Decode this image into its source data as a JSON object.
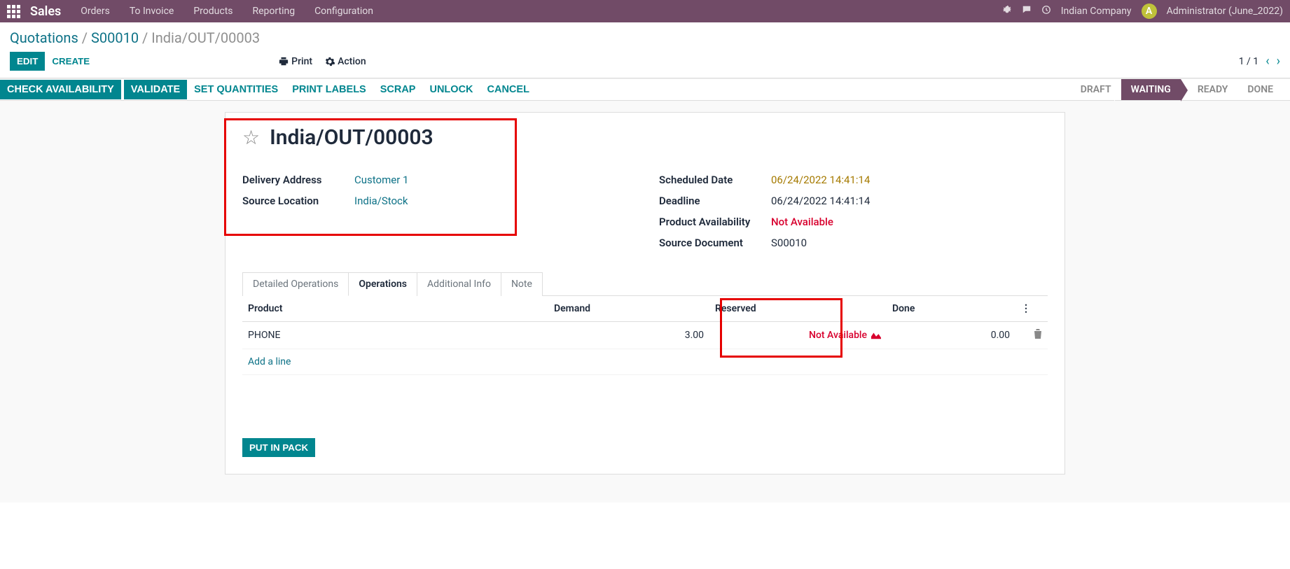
{
  "topnav": {
    "app_name": "Sales",
    "menu": [
      "Orders",
      "To Invoice",
      "Products",
      "Reporting",
      "Configuration"
    ],
    "company": "Indian Company",
    "avatar_letter": "A",
    "user": "Administrator (June_2022)"
  },
  "breadcrumb": {
    "root": "Quotations",
    "parent": "S00010",
    "current": "India/OUT/00003"
  },
  "actions": {
    "edit": "EDIT",
    "create": "CREATE",
    "print": "Print",
    "action": "Action",
    "pager": "1 / 1"
  },
  "statusbar": {
    "buttons": {
      "check_availability": "CHECK AVAILABILITY",
      "validate": "VALIDATE",
      "set_quantities": "SET QUANTITIES",
      "print_labels": "PRINT LABELS",
      "scrap": "SCRAP",
      "unlock": "UNLOCK",
      "cancel": "CANCEL"
    },
    "statuses": {
      "draft": "DRAFT",
      "waiting": "WAITING",
      "ready": "READY",
      "done": "DONE"
    },
    "active": "waiting"
  },
  "record": {
    "title": "India/OUT/00003",
    "fields": {
      "delivery_address_label": "Delivery Address",
      "delivery_address_value": "Customer 1",
      "source_location_label": "Source Location",
      "source_location_value": "India/Stock",
      "scheduled_date_label": "Scheduled Date",
      "scheduled_date_value": "06/24/2022 14:41:14",
      "deadline_label": "Deadline",
      "deadline_value": "06/24/2022 14:41:14",
      "product_availability_label": "Product Availability",
      "product_availability_value": "Not Available",
      "source_document_label": "Source Document",
      "source_document_value": "S00010"
    }
  },
  "tabs": {
    "detailed_operations": "Detailed Operations",
    "operations": "Operations",
    "additional_info": "Additional Info",
    "note": "Note"
  },
  "table": {
    "headers": {
      "product": "Product",
      "demand": "Demand",
      "reserved": "Reserved",
      "done": "Done"
    },
    "rows": [
      {
        "product": "PHONE",
        "demand": "3.00",
        "reserved": "Not Available",
        "done": "0.00"
      }
    ],
    "add_line": "Add a line"
  },
  "put_in_pack": "PUT IN PACK"
}
